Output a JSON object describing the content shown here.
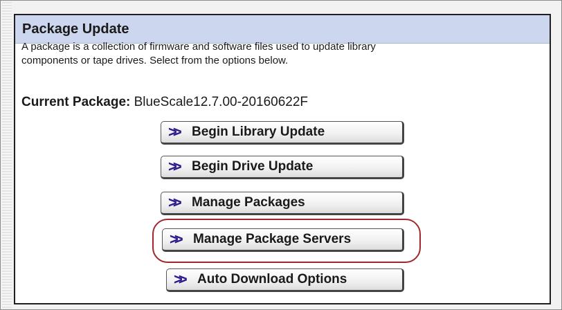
{
  "panel": {
    "title": "Package Update",
    "description_line1": "A package is a collection of firmware and software files used to update library",
    "description_line2": "components or tape drives. Select from the options below.",
    "current_package_label": "Current Package:",
    "current_package_value": "BlueScale12.7.00-20160622F"
  },
  "buttons": [
    {
      "label": "Begin Library Update",
      "icon": "double-chevron-right-icon"
    },
    {
      "label": "Begin Drive Update",
      "icon": "double-chevron-right-icon"
    },
    {
      "label": "Manage Packages",
      "icon": "double-chevron-right-icon"
    },
    {
      "label": "Manage Package Servers",
      "icon": "double-chevron-right-icon"
    },
    {
      "label": "Auto Download Options",
      "icon": "double-chevron-right-icon"
    }
  ],
  "colors": {
    "header_bg": "#ccd6ee",
    "chevron": "#2a1a8c",
    "highlight_ring": "#a0272c"
  }
}
